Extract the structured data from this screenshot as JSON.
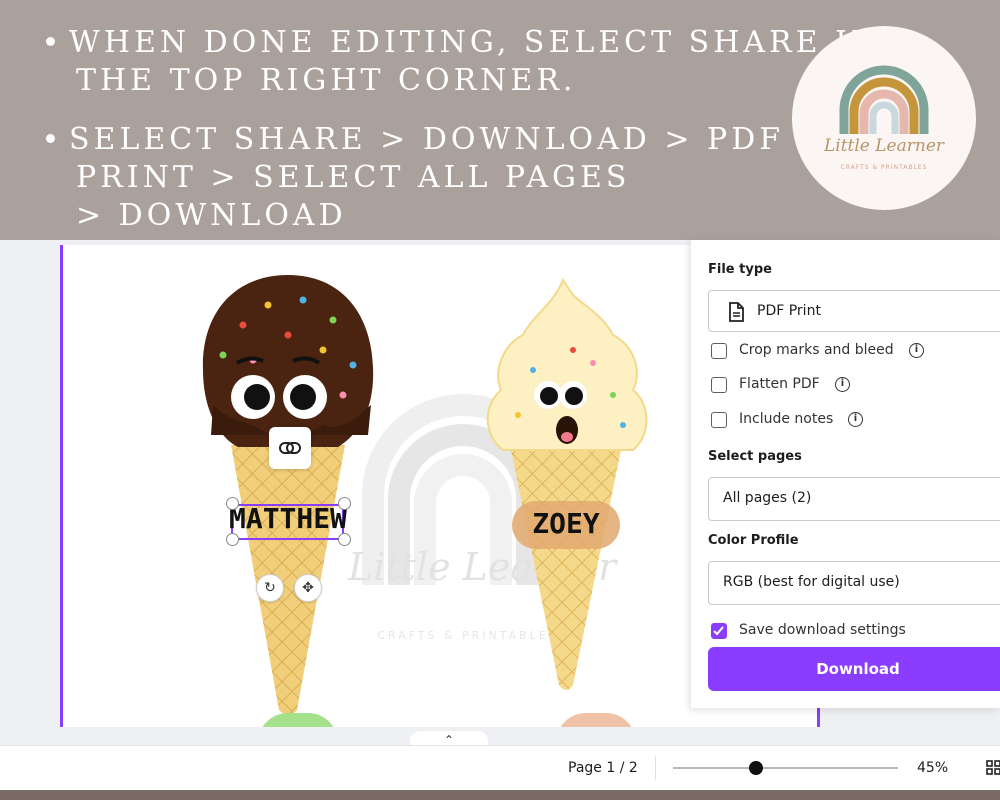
{
  "banner": {
    "bullet1_line1": "When done editing, select share in",
    "bullet1_line2": "the top right corner.",
    "bullet2_line1": "Select share > download > PDF",
    "bullet2_line2": "print > select all pages",
    "bullet2_line3": "> download"
  },
  "logo": {
    "title": "Little Learner",
    "tagline": "CRAFTS & PRINTABLES"
  },
  "watermark": {
    "title": "Little Learner",
    "tagline": "CRAFTS & PRINTABLES"
  },
  "canvas": {
    "items": [
      {
        "name": "MATTHEW"
      },
      {
        "name": "ZOEY"
      }
    ]
  },
  "panel": {
    "file_type_label": "File type",
    "file_type_value": "PDF Print",
    "file_type_icon": "document-icon",
    "options": [
      {
        "label": "Crop marks and bleed",
        "checked": false
      },
      {
        "label": "Flatten PDF",
        "checked": false
      },
      {
        "label": "Include notes",
        "checked": false
      }
    ],
    "select_pages_label": "Select pages",
    "select_pages_value": "All pages (2)",
    "color_profile_label": "Color Profile",
    "color_profile_value": "RGB (best for digital use)",
    "save_settings_label": "Save download settings",
    "save_settings_checked": true,
    "download_label": "Download"
  },
  "bottombar": {
    "page_indicator": "Page 1 / 2",
    "zoom": "45%",
    "zoom_fraction": 0.37
  },
  "colors": {
    "accent": "#8b3dff",
    "banner": "#aba19c"
  }
}
